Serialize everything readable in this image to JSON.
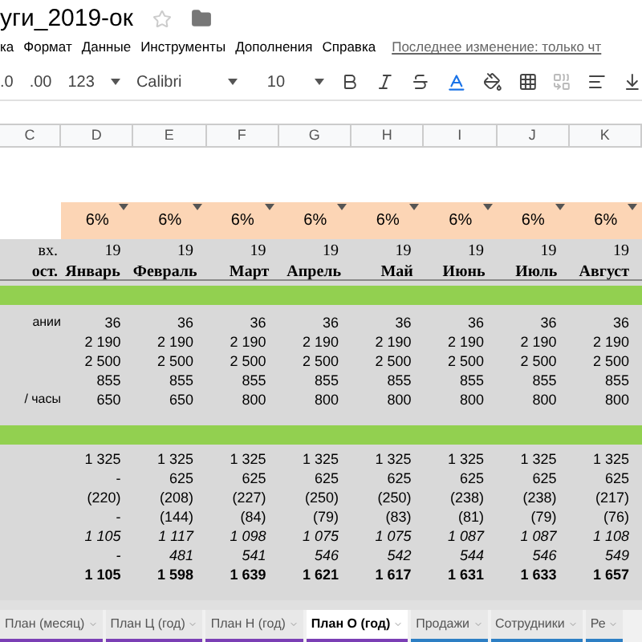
{
  "title": "уги_2019-ок",
  "menu": [
    "ка",
    "Формат",
    "Данные",
    "Инструменты",
    "Дополнения",
    "Справка"
  ],
  "last_edit": "Последнее изменение: только чт",
  "toolbar": {
    "decimals": [
      ".0",
      ".00"
    ],
    "number_format": "123",
    "font": "Calibri",
    "font_size": "10"
  },
  "columns": [
    "C",
    "D",
    "E",
    "F",
    "G",
    "H",
    "I",
    "J",
    "K"
  ],
  "rate_row": [
    "6%",
    "6%",
    "6%",
    "6%",
    "6%",
    "6%",
    "6%",
    "6%"
  ],
  "header_rows": [
    {
      "label": "вх.",
      "values": [
        "19",
        "19",
        "19",
        "19",
        "19",
        "19",
        "19",
        "19"
      ]
    },
    {
      "label": "ост.",
      "values": [
        "Январь",
        "Февраль",
        "Март",
        "Апрель",
        "Май",
        "Июнь",
        "Июль",
        "Август"
      ]
    }
  ],
  "upper_rows": [
    {
      "label": "ании",
      "values": [
        "36",
        "36",
        "36",
        "36",
        "36",
        "36",
        "36",
        "36"
      ]
    },
    {
      "values": [
        "2 190",
        "2 190",
        "2 190",
        "2 190",
        "2 190",
        "2 190",
        "2 190",
        "2 190"
      ]
    },
    {
      "values": [
        "2 500",
        "2 500",
        "2 500",
        "2 500",
        "2 500",
        "2 500",
        "2 500",
        "2 500"
      ]
    },
    {
      "values": [
        "855",
        "855",
        "855",
        "855",
        "855",
        "855",
        "855",
        "855"
      ]
    },
    {
      "label": "/ часы",
      "values": [
        "650",
        "650",
        "800",
        "800",
        "800",
        "800",
        "800",
        "800"
      ]
    }
  ],
  "lower_rows": [
    {
      "kind": "normal",
      "values": [
        "1 325",
        "1 325",
        "1 325",
        "1 325",
        "1 325",
        "1 325",
        "1 325",
        "1 325"
      ]
    },
    {
      "kind": "normal",
      "values": [
        "-",
        "625",
        "625",
        "625",
        "625",
        "625",
        "625",
        "625"
      ]
    },
    {
      "kind": "normal",
      "values": [
        "(220)",
        "(208)",
        "(227)",
        "(250)",
        "(250)",
        "(238)",
        "(238)",
        "(217)"
      ]
    },
    {
      "kind": "normal",
      "values": [
        "-",
        "(144)",
        "(84)",
        "(79)",
        "(83)",
        "(81)",
        "(79)",
        "(76)"
      ]
    },
    {
      "kind": "italic",
      "values": [
        "1 105",
        "1 117",
        "1 098",
        "1 075",
        "1 075",
        "1 087",
        "1 087",
        "1 108"
      ]
    },
    {
      "kind": "italic",
      "values": [
        "-",
        "481",
        "541",
        "546",
        "542",
        "544",
        "546",
        "549"
      ]
    },
    {
      "kind": "bold",
      "values": [
        "1 105",
        "1 598",
        "1 639",
        "1 621",
        "1 617",
        "1 631",
        "1 633",
        "1 657"
      ]
    }
  ],
  "tabs": [
    {
      "label": "План (месяц)",
      "selected": false,
      "color": "#7b3fb5"
    },
    {
      "label": "План Ц (год)",
      "selected": false,
      "color": "#7b3fb5"
    },
    {
      "label": "План Н (год)",
      "selected": false,
      "color": "#7b3fb5"
    },
    {
      "label": "План О (год)",
      "selected": true,
      "color": "#7b3fb5"
    },
    {
      "label": "Продажи",
      "selected": false,
      "color": "#2d7fc4"
    },
    {
      "label": "Сотрудники",
      "selected": false,
      "color": "#2d7fc4"
    },
    {
      "label": "Ре",
      "selected": false,
      "color": "#2d7fc4"
    }
  ]
}
